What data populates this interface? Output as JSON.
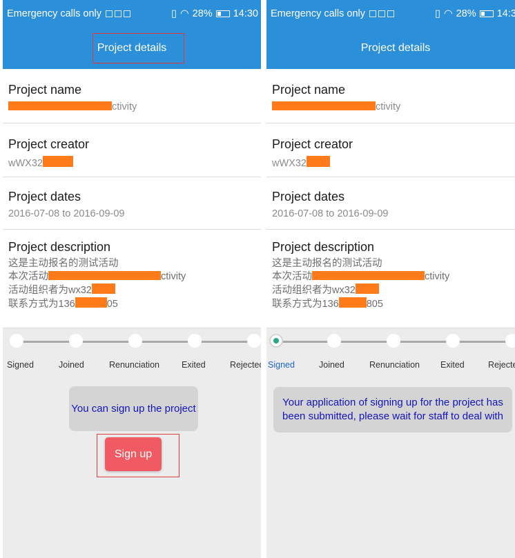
{
  "status_bar": {
    "carrier": "Emergency calls only",
    "battery": "28%",
    "time": "14:30"
  },
  "header": {
    "title": "Project details"
  },
  "fields": {
    "name_label": "Project name",
    "name_suffix": "ctivity",
    "creator_label": "Project creator",
    "creator_prefix": "wWX32",
    "dates_label": "Project dates",
    "dates_value": "2016-07-08 to 2016-09-09",
    "desc_label": "Project description",
    "desc_line1": "这是主动报名的测试活动",
    "desc_line2_prefix": "本次活动",
    "desc_line2_suffix": "ctivity",
    "desc_line3_prefix": "活动组织者为wx32",
    "desc_line4_prefix": "联系方式为136",
    "desc_line4_suffix_left": "05",
    "desc_line4_suffix_right": "805"
  },
  "timeline": {
    "steps": [
      "Signed",
      "Joined",
      "Renunciation",
      "Exited",
      "Rejected"
    ],
    "right_last_visible": "Rejecte",
    "left_active_index": -1,
    "right_active_index": 0
  },
  "left_screen": {
    "message": "You can sign up the project",
    "signup_label": "Sign up"
  },
  "right_screen": {
    "message": "Your application of signing up for the project has been submitted, please wait for staff to deal with"
  },
  "colors": {
    "header_bg": "#2b90d9",
    "redaction": "#ff7a18",
    "signup_button": "#ef5a63",
    "highlight_box": "#e03a3a",
    "active_step": "#2aa787",
    "message_text": "#1414b8"
  }
}
